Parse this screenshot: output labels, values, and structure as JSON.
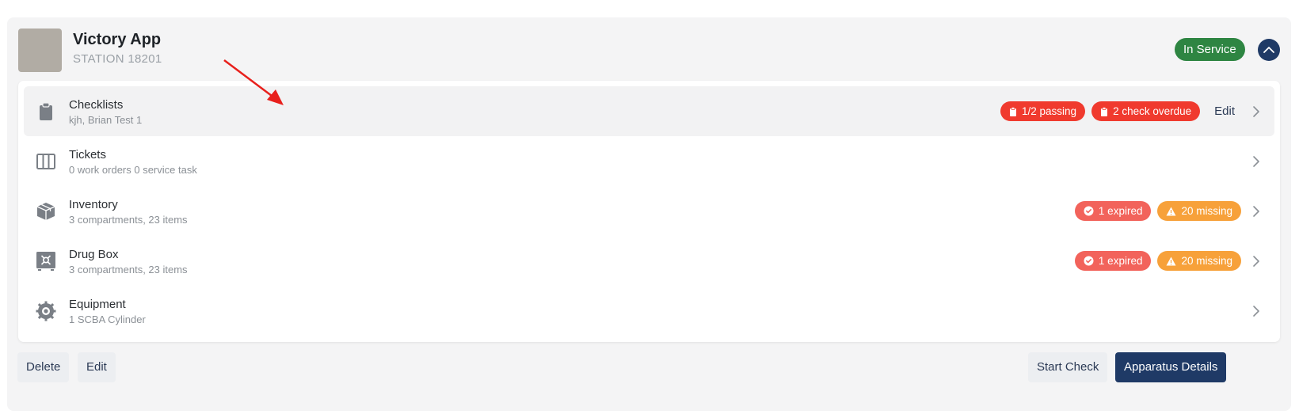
{
  "header": {
    "title": "Victory App",
    "subtitle": "STATION 18201",
    "status": "In Service",
    "thumbnail_color": "#b1aca4",
    "status_color": "#2e8542"
  },
  "rows": [
    {
      "title": "Checklists",
      "subtitle": "kjh, Brian Test 1",
      "icon": "clipboard-icon",
      "badges": [
        {
          "label": "1/2 passing",
          "icon": "clipboard-icon",
          "color": "#f03a2e"
        },
        {
          "label": "2 check overdue",
          "icon": "clipboard-icon",
          "color": "#f03a2e"
        }
      ],
      "action": "Edit"
    },
    {
      "title": "Tickets",
      "subtitle": "0 work orders 0 service task",
      "icon": "columns-icon"
    },
    {
      "title": "Inventory",
      "subtitle": "3 compartments, 23 items",
      "icon": "box-icon",
      "badges": [
        {
          "label": "1 expired",
          "icon": "check-circle-icon",
          "color": "#f2635b"
        },
        {
          "label": "20 missing",
          "icon": "warning-icon",
          "color": "#f7a13a"
        }
      ]
    },
    {
      "title": "Drug Box",
      "subtitle": "3 compartments, 23 items",
      "icon": "safe-icon",
      "badges": [
        {
          "label": "1 expired",
          "icon": "check-circle-icon",
          "color": "#f2635b"
        },
        {
          "label": "20 missing",
          "icon": "warning-icon",
          "color": "#f7a13a"
        }
      ]
    },
    {
      "title": "Equipment",
      "subtitle": "1 SCBA Cylinder",
      "icon": "gear-icon"
    }
  ],
  "footer": {
    "delete_label": "Delete",
    "edit_label": "Edit",
    "start_check_label": "Start Check",
    "details_label": "Apparatus Details"
  },
  "colors": {
    "accent": "#1f3a66",
    "annotation_arrow": "#e8201c"
  }
}
